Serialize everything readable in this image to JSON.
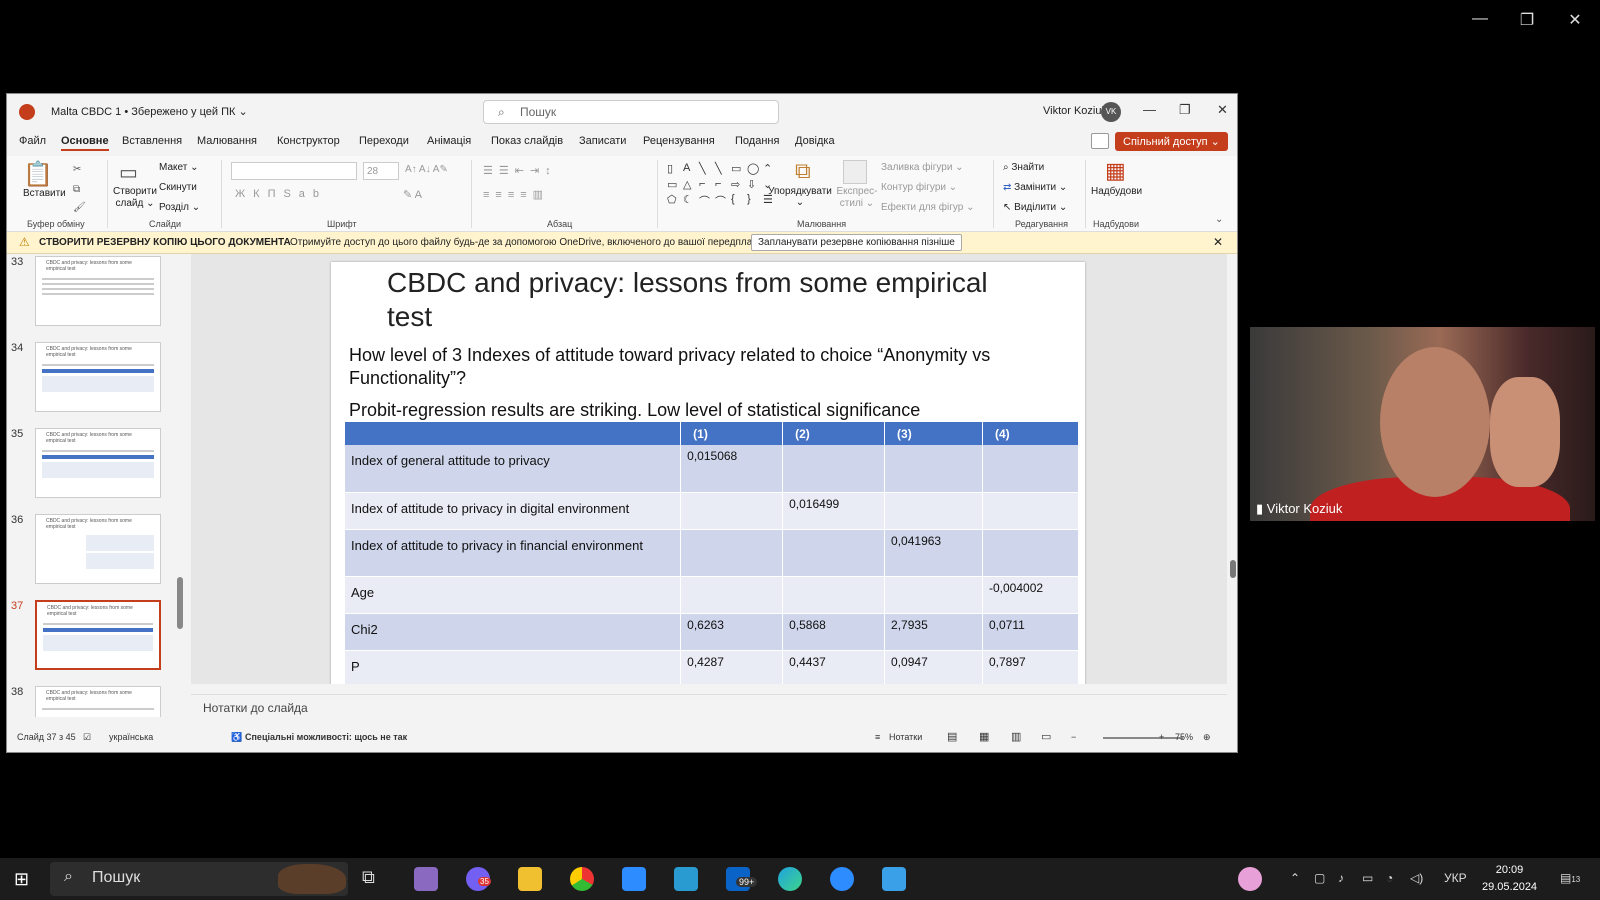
{
  "window_controls": {
    "minimize": "—",
    "restore": "❐",
    "close": "✕"
  },
  "ppt": {
    "title": "Malta CBDC 1 • Збережено у цей ПК ⌄",
    "search_placeholder": "Пошук",
    "user_name": "Viktor Koziuk",
    "user_initials": "VK",
    "menu": [
      "Файл",
      "Основне",
      "Вставлення",
      "Малювання",
      "Конструктор",
      "Переходи",
      "Анімація",
      "Показ слайдів",
      "Записати",
      "Рецензування",
      "Подання",
      "Довідка"
    ],
    "active_menu": "Основне",
    "share_label": "Спільний доступ ⌄",
    "ribbon": {
      "paste": "Вставити",
      "clipboard_group": "Буфер обміну",
      "new_slide": "Створити слайд ⌄",
      "layout": "Макет ⌄",
      "reset": "Скинути",
      "section": "Розділ ⌄",
      "slides_group": "Слайди",
      "font_size": "28",
      "font_group": "Шрифт",
      "paragraph_group": "Абзац",
      "arrange": "Упорядкувати ⌄",
      "quick_styles": "Експрес-стилі ⌄",
      "shape_fill": "Заливка фігури ⌄",
      "shape_outline": "Контур фігури ⌄",
      "shape_effects": "Ефекти для фігур ⌄",
      "drawing_group": "Малювання",
      "find": "Знайти",
      "replace": "Замінити ⌄",
      "select": "Виділити ⌄",
      "editing_group": "Редагування",
      "addins": "Надбудови",
      "addins_group": "Надбудови"
    },
    "notice": {
      "title": "СТВОРИТИ РЕЗЕРВНУ КОПІЮ ЦЬОГО ДОКУМЕНТА",
      "text": "Отримуйте доступ до цього файлу будь-де за допомогою OneDrive, включеного до вашої передплати.",
      "button": "Запланувати резервне копіювання пізніше"
    },
    "thumbnails": [
      {
        "num": "33",
        "title": "CBDC and privacy: lessons from some empirical test"
      },
      {
        "num": "34",
        "title": "CBDC and privacy: lessons from some empirical test"
      },
      {
        "num": "35",
        "title": "CBDC and privacy: lessons from some empirical test"
      },
      {
        "num": "36",
        "title": "CBDC and privacy: lessons from some empirical test"
      },
      {
        "num": "37",
        "title": "CBDC and privacy: lessons from some empirical test"
      },
      {
        "num": "38",
        "title": "CBDC and privacy: lessons from some empirical test"
      }
    ],
    "slide": {
      "title": "CBDC and privacy: lessons from some empirical test",
      "question": "How level of 3 Indexes of attitude toward privacy related to choice “Anonymity vs Functionality”?",
      "result": "Probit-regression results are striking. Low level of statistical significance",
      "table": {
        "headers": [
          "",
          "(1)",
          "(2)",
          "(3)",
          "(4)"
        ],
        "rows": [
          [
            "Index of general attitude to privacy",
            "0,015068",
            "",
            "",
            ""
          ],
          [
            "Index of attitude to privacy in digital environment",
            "",
            "0,016499",
            "",
            ""
          ],
          [
            "Index of attitude to privacy in financial environment",
            "",
            "",
            "0,041963",
            ""
          ],
          [
            "Age",
            "",
            "",
            "",
            "-0,004002"
          ],
          [
            "Chi2",
            "0,6263",
            "0,5868",
            "2,7935",
            "0,0711"
          ],
          [
            "P",
            "0,4287",
            "0,4437",
            "0,0947",
            "0,7897"
          ]
        ]
      }
    },
    "notes_label": "Нотатки до слайда",
    "status": {
      "slide_of": "Слайд 37 з 45",
      "language": "українська",
      "accessibility": "Спеціальні можливості: щось не так",
      "notes": "Нотатки",
      "zoom": "75%"
    }
  },
  "video": {
    "participant": "Viktor Koziuk"
  },
  "taskbar": {
    "search": "Пошук",
    "mail_badge": "99+",
    "viber_badge": "35",
    "language": "УКР",
    "time": "20:09",
    "date": "29.05.2024",
    "notif_count": "13"
  }
}
